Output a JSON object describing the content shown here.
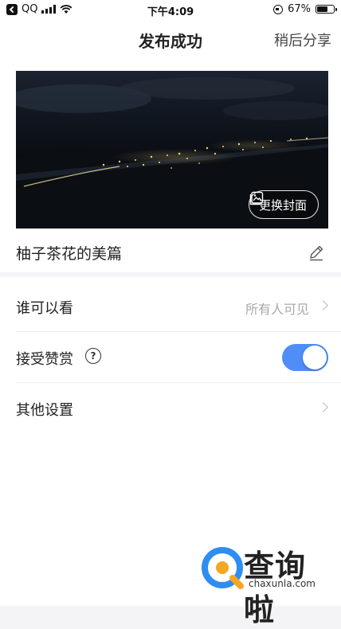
{
  "status_bar": {
    "app": "QQ",
    "time": "下午4:09",
    "battery": "67%",
    "battery_level": 0.67
  },
  "header": {
    "title": "发布成功",
    "share_label": "稍后分享"
  },
  "card": {
    "change_cover_label": "更换封面",
    "post_title": "柚子茶花的美篇"
  },
  "settings": {
    "visibility": {
      "label": "谁可以看",
      "value": "所有人可见"
    },
    "reward": {
      "label": "接受赞赏",
      "help": "?",
      "enabled": true
    },
    "other": {
      "label": "其他设置"
    }
  },
  "watermark": {
    "text": "查询啦",
    "url": "chaxunla.com"
  },
  "colors": {
    "accent": "#4f8ef7",
    "background": "#f4f4f6"
  }
}
